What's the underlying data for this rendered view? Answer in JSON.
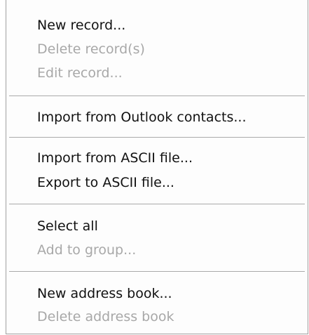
{
  "menu": {
    "items": [
      {
        "label": "New record...",
        "enabled": true
      },
      {
        "label": "Delete record(s)",
        "enabled": false
      },
      {
        "label": "Edit record...",
        "enabled": false
      },
      {
        "label": "Import from Outlook contacts...",
        "enabled": true
      },
      {
        "label": "Import from ASCII file...",
        "enabled": true
      },
      {
        "label": "Export to ASCII file...",
        "enabled": true
      },
      {
        "label": "Select all",
        "enabled": true
      },
      {
        "label": "Add to group...",
        "enabled": false
      },
      {
        "label": "New address book...",
        "enabled": true
      },
      {
        "label": "Delete address book",
        "enabled": false
      }
    ]
  },
  "colors": {
    "enabled_text": "#111111",
    "disabled_text": "#a8a8a8",
    "separator": "#a9a9a9",
    "menu_background": "#fdfdfd"
  }
}
